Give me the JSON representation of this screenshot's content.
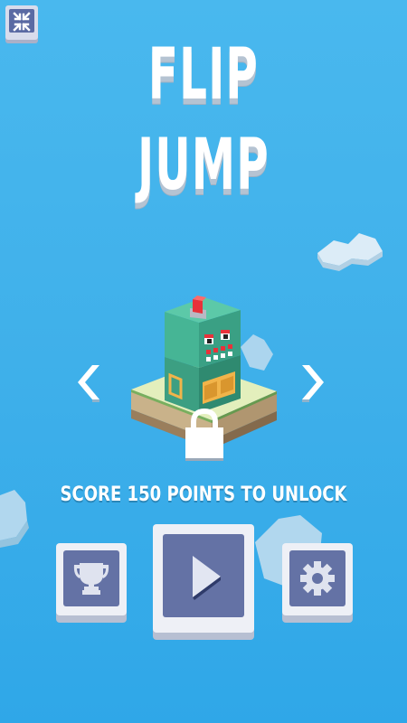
{
  "game": {
    "title_line1": "FLIP",
    "title_line2": "JUMP",
    "unlock_message": "SCORE 150 POINTS TO UNLOCK"
  },
  "icons": {
    "exit_fullscreen": "compress-arrows-icon",
    "prev": "chevron-left-icon",
    "next": "chevron-right-icon",
    "lock": "padlock-icon",
    "leaderboard": "trophy-icon",
    "play": "play-icon",
    "settings": "gear-icon"
  },
  "colors": {
    "sky_top": "#49b8ee",
    "sky_bottom": "#2fa7e8",
    "button_face": "#6472a5",
    "button_frame": "#eef0f6",
    "robot_body": "#3fae8d",
    "robot_light": "#e8323a"
  }
}
